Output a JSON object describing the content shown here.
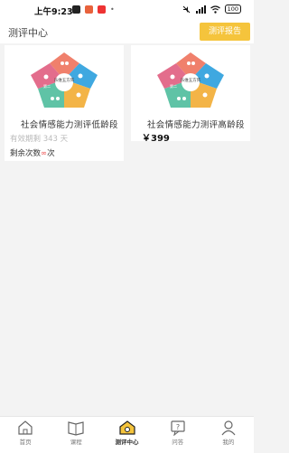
{
  "status": {
    "time": "上午9:23",
    "battery": "100"
  },
  "header": {
    "title": "测评中心",
    "report_button": "测评报告"
  },
  "cards": [
    {
      "title": "社会情感能力测评低龄段",
      "validity": "有效期剩 343 天",
      "remaining_prefix": "剩余次数",
      "remaining_value": "∞",
      "remaining_suffix": "次",
      "image_label_center": "乐维五方阵",
      "image_label_left": "第二"
    },
    {
      "title": "社会情感能力测评高龄段",
      "price": "￥399",
      "image_label_center": "乐维五方阵",
      "image_label_left": "第二"
    }
  ],
  "nav": [
    {
      "label": "首页",
      "icon": "home-icon"
    },
    {
      "label": "课程",
      "icon": "book-icon"
    },
    {
      "label": "测评中心",
      "icon": "assessment-icon",
      "active": true
    },
    {
      "label": "问答",
      "icon": "qa-icon"
    },
    {
      "label": "我的",
      "icon": "person-icon"
    }
  ],
  "colors": {
    "accent": "#f5c43c",
    "pentagon": [
      "#f0806c",
      "#f3b447",
      "#5fc3a6",
      "#3fa8e0",
      "#e36d8c"
    ]
  }
}
